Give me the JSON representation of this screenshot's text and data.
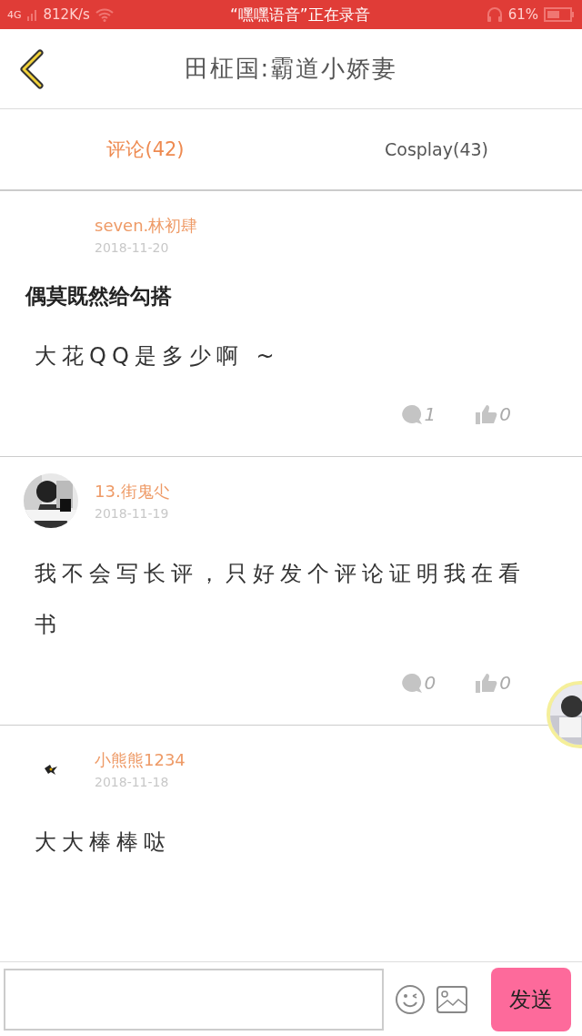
{
  "status_bar": {
    "network": "4G",
    "speed": "812K/s",
    "notice": "“嘿嘿语音”正在录音",
    "battery": "61%"
  },
  "header": {
    "title": "田柾国:霸道小娇妻"
  },
  "tabs": [
    {
      "label": "评论(42)",
      "selected": true
    },
    {
      "label": "Cosplay(43)",
      "selected": false
    }
  ],
  "comments": [
    {
      "kind": "no-avatar",
      "name": "seven.林初肆",
      "date": "2018-11-20",
      "title": "偶莫既然给勾搭",
      "body": "大花QQ是多少啊 ~",
      "replies": "1",
      "likes": "0"
    },
    {
      "kind": "photo-avatar",
      "name": "13.街鬼尐",
      "date": "2018-11-19",
      "body": "我不会写长评，只好发个评论证明我在看书",
      "replies": "0",
      "likes": "0"
    },
    {
      "kind": "bird-avatar",
      "name": "小熊熊1234",
      "date": "2018-11-18",
      "body": "大大棒棒哒"
    }
  ],
  "input_bar": {
    "send": "发送"
  }
}
